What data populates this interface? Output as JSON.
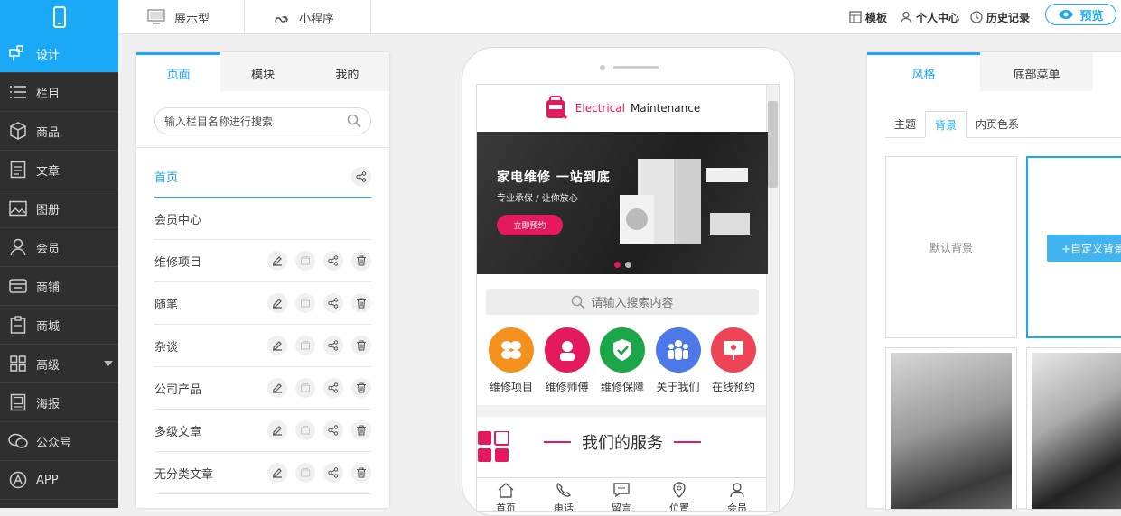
{
  "top": {
    "tabs": [
      "展示型",
      "小程序"
    ],
    "right": {
      "template": "模板",
      "user_center": "个人中心",
      "history": "历史记录",
      "preview": "预览"
    }
  },
  "sidebar": {
    "items": [
      {
        "label": "设计",
        "icon": "design-icon",
        "active": true
      },
      {
        "label": "栏目",
        "icon": "list-icon"
      },
      {
        "label": "商品",
        "icon": "box-icon"
      },
      {
        "label": "文章",
        "icon": "article-icon"
      },
      {
        "label": "图册",
        "icon": "image-icon"
      },
      {
        "label": "会员",
        "icon": "user-icon"
      },
      {
        "label": "商铺",
        "icon": "shop-icon"
      },
      {
        "label": "商城",
        "icon": "mall-icon"
      },
      {
        "label": "高级",
        "icon": "grid-icon",
        "has_dropdown": true
      },
      {
        "label": "海报",
        "icon": "poster-icon"
      },
      {
        "label": "公众号",
        "icon": "wechat-icon"
      },
      {
        "label": "APP",
        "icon": "app-icon"
      }
    ]
  },
  "left_panel": {
    "tabs": [
      "页面",
      "模块",
      "我的"
    ],
    "search_placeholder": "输入栏目名称进行搜索",
    "pages": [
      "首页",
      "会员中心",
      "维修项目",
      "随笔",
      "杂谈",
      "公司产品",
      "多级文章",
      "无分类文章"
    ]
  },
  "phone": {
    "brand_pre": "Electrical",
    "brand_post": "Maintenance",
    "banner": {
      "title": "家电维修 一站到底",
      "subtitle": "专业承保 / 让你放心",
      "button": "立即预约"
    },
    "search_placeholder": "请输入搜索内容",
    "categories": [
      {
        "label": "维修项目",
        "color": "#f4901c"
      },
      {
        "label": "维修师傅",
        "color": "#e5195e"
      },
      {
        "label": "维修保障",
        "color": "#1ca64a"
      },
      {
        "label": "关于我们",
        "color": "#4d78e8"
      },
      {
        "label": "在线预约",
        "color": "#ef4455"
      }
    ],
    "section_title": "我们的服务",
    "bottom_nav": [
      "首页",
      "电话",
      "留言",
      "位置",
      "会员"
    ]
  },
  "right_panel": {
    "tabs": [
      "风格",
      "底部菜单"
    ],
    "subtabs": [
      "主题",
      "背景",
      "内页色系"
    ],
    "default_bg": "默认背景",
    "custom_bg": "+自定义背景"
  },
  "colors": {
    "accent": "#19a9f7",
    "brand": "#e5195e"
  }
}
